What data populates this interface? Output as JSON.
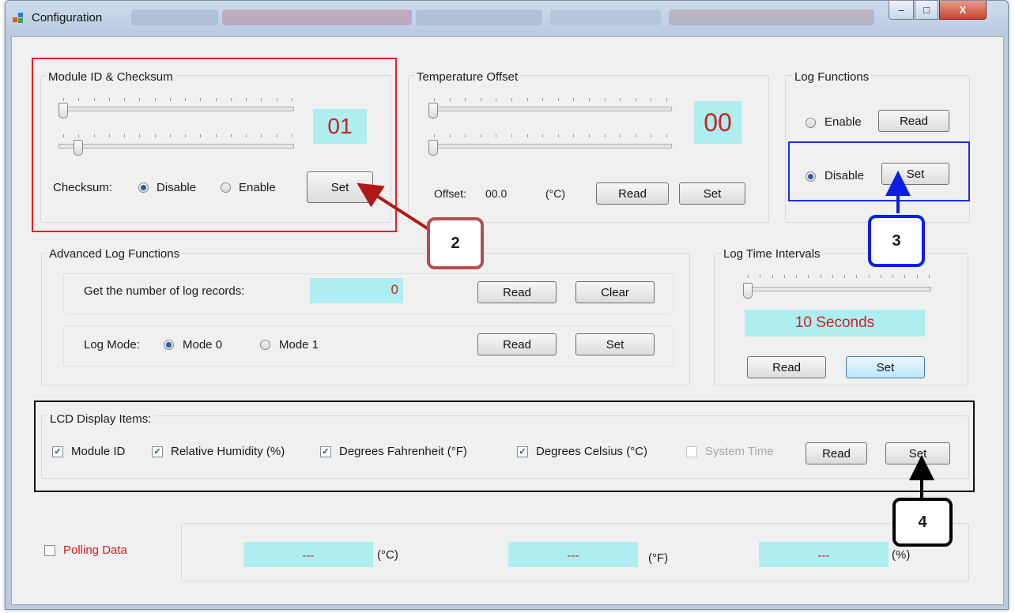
{
  "window": {
    "title": "Configuration",
    "min_label": "–",
    "max_label": "□",
    "close_label": "X"
  },
  "module": {
    "group_title": "Module ID & Checksum",
    "id_value": "01",
    "id_slider_level": 0,
    "checksum_slider_level": 0.07,
    "checksum_label": "Checksum:",
    "opt_disable": "Disable",
    "opt_enable": "Enable",
    "checksum_selected": "Disable",
    "set_label": "Set"
  },
  "temperature": {
    "group_title": "Temperature Offset",
    "value": "00",
    "offset_label": "Offset:",
    "offset_value": "00.0",
    "unit": "(°C)",
    "read_label": "Read",
    "set_label": "Set"
  },
  "log_functions": {
    "group_title": "Log Functions",
    "opt_enable": "Enable",
    "opt_disable": "Disable",
    "selected": "Disable",
    "read_label": "Read",
    "set_label": "Set"
  },
  "advanced": {
    "group_title": "Advanced Log Functions",
    "records_label": "Get the number of log records:",
    "records_value": "0",
    "read_label": "Read",
    "clear_label": "Clear",
    "mode_label": "Log Mode:",
    "mode0": "Mode 0",
    "mode1": "Mode 1",
    "mode_selected": "Mode 0",
    "mode_read_label": "Read",
    "mode_set_label": "Set"
  },
  "intervals": {
    "group_title": "Log Time Intervals",
    "value": "10 Seconds",
    "slider_level": 0,
    "read_label": "Read",
    "set_label": "Set"
  },
  "lcd": {
    "group_title": "LCD Display Items:",
    "items": [
      {
        "label": "Module ID",
        "checked": true,
        "enabled": true
      },
      {
        "label": "Relative Humidity (%)",
        "checked": true,
        "enabled": true
      },
      {
        "label": "Degrees Fahrenheit  (°F)",
        "checked": true,
        "enabled": true
      },
      {
        "label": "Degrees Celsius (°C)",
        "checked": true,
        "enabled": true
      },
      {
        "label": "System Time",
        "checked": false,
        "enabled": false
      }
    ],
    "read_label": "Read",
    "set_label": "Set"
  },
  "polling": {
    "label": "Polling Data",
    "checked": false,
    "c_value": "---",
    "c_unit": "(°C)",
    "f_value": "---",
    "f_unit": "(°F)",
    "h_value": "---",
    "h_unit": "(%)"
  },
  "callouts": {
    "c2": "2",
    "c3": "3",
    "c4": "4"
  },
  "colors": {
    "display_bg": "#aeeef0",
    "display_text": "#d02020",
    "polling_text": "#d02020",
    "callout2": "#b05050",
    "callout3": "#0a1ee6",
    "callout4": "#000000",
    "highlight_module": "#e82020",
    "highlight_log": "#1a2ee0",
    "highlight_lcd": "#111111"
  }
}
